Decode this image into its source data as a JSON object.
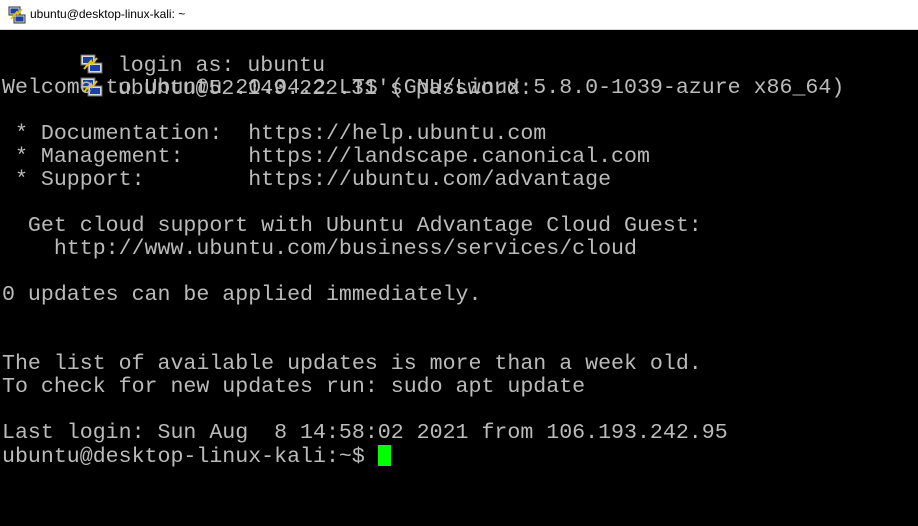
{
  "window": {
    "title": "ubuntu@desktop-linux-kali: ~"
  },
  "terminal": {
    "login_prompt": "login as: ubuntu",
    "password_prompt": "ubuntu@52.149.222.31's password:",
    "welcome": "Welcome to Ubuntu 20.04.2 LTS (GNU/Linux 5.8.0-1039-azure x86_64)",
    "doc_line": " * Documentation:  https://help.ubuntu.com",
    "mgmt_line": " * Management:     https://landscape.canonical.com",
    "support_line": " * Support:        https://ubuntu.com/advantage",
    "cloud_line_1": "  Get cloud support with Ubuntu Advantage Cloud Guest:",
    "cloud_line_2": "    http://www.ubuntu.com/business/services/cloud",
    "updates_line": "0 updates can be applied immediately.",
    "list_line_1": "The list of available updates is more than a week old.",
    "list_line_2": "To check for new updates run: sudo apt update",
    "last_login": "Last login: Sun Aug  8 14:58:02 2021 from 106.193.242.95",
    "prompt": "ubuntu@desktop-linux-kali:~$ "
  },
  "colors": {
    "background": "#000000",
    "text": "#bbbbbb",
    "cursor": "#00ff00"
  },
  "icons": {
    "app": "putty-icon",
    "line": "putty-icon"
  }
}
